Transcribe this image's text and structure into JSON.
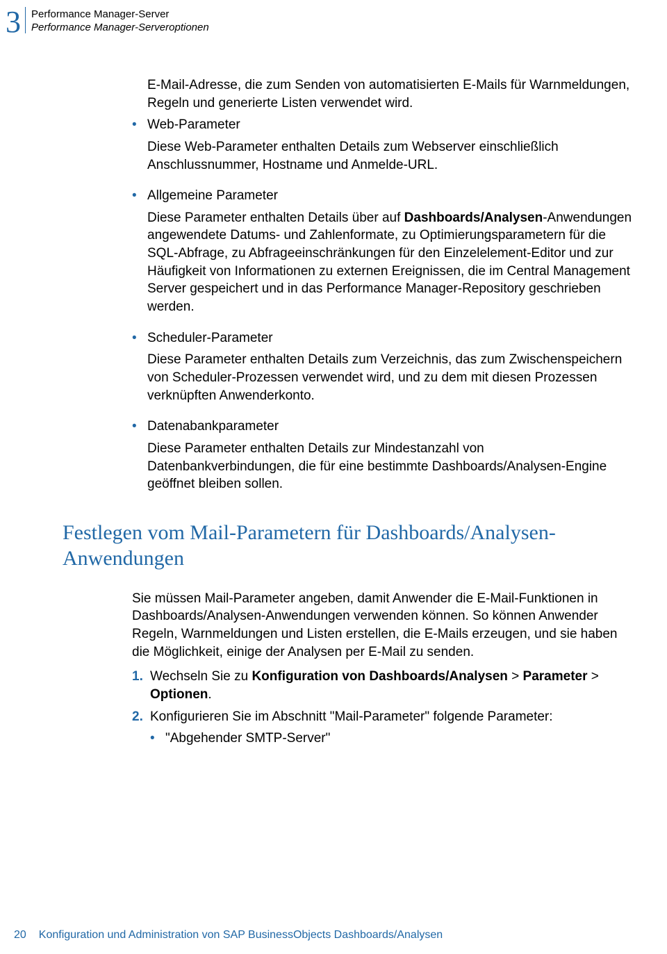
{
  "header": {
    "chapter_number": "3",
    "title": "Performance Manager-Server",
    "subtitle": "Performance Manager-Serveroptionen"
  },
  "intro_para": "E-Mail-Adresse, die zum Senden von automatisierten E-Mails für Warnmeldungen, Regeln und generierte Listen verwendet wird.",
  "bullets": [
    {
      "label": "Web-Parameter",
      "desc": "Diese Web-Parameter enthalten Details zum Webserver einschließlich Anschlussnummer, Hostname und Anmelde-URL."
    },
    {
      "label": "Allgemeine Parameter",
      "desc_pre": "Diese Parameter enthalten Details über auf ",
      "desc_bold": "Dashboards/Analysen",
      "desc_post": "-Anwendungen angewendete Datums- und Zahlenformate, zu Optimierungsparametern für die SQL-Abfrage, zu Abfrageeinschränkungen für den Einzelelement-Editor und zur Häufigkeit von Informationen zu externen Ereignissen, die im Central Management Server gespeichert und in das Performance Manager-Repository geschrieben werden."
    },
    {
      "label": "Scheduler-Parameter",
      "desc": "Diese Parameter enthalten Details zum Verzeichnis, das zum Zwischenspeichern von Scheduler-Prozessen verwendet wird, und zu dem mit diesen Prozessen verknüpften Anwenderkonto."
    },
    {
      "label": "Datenabankparameter",
      "desc": "Diese Parameter enthalten Details zur Mindestanzahl von Datenbankverbindungen, die für eine bestimmte Dashboards/Analysen-Engine geöffnet bleiben sollen."
    }
  ],
  "section_heading": "Festlegen vom Mail-Parametern für Dashboards/Analysen-Anwendungen",
  "section_para": "Sie müssen Mail-Parameter angeben, damit Anwender die E-Mail-Funktionen in Dashboards/Analysen-Anwendungen verwenden können. So können Anwender Regeln, Warnmeldungen und Listen erstellen, die E-Mails erzeugen, und sie haben die Möglichkeit, einige der Analysen per E-Mail zu senden.",
  "steps": [
    {
      "num": "1.",
      "pre": "Wechseln Sie zu ",
      "b1": "Konfiguration von Dashboards/Analysen",
      "mid1": " > ",
      "b2": "Parameter",
      "mid2": " > ",
      "b3": "Optionen",
      "post": "."
    },
    {
      "num": "2.",
      "text": "Konfigurieren Sie im Abschnitt \"Mail-Parameter\" folgende Parameter:",
      "sub": "\"Abgehender SMTP-Server\""
    }
  ],
  "footer": {
    "page": "20",
    "text": "Konfiguration und Administration von SAP BusinessObjects Dashboards/Analysen"
  }
}
